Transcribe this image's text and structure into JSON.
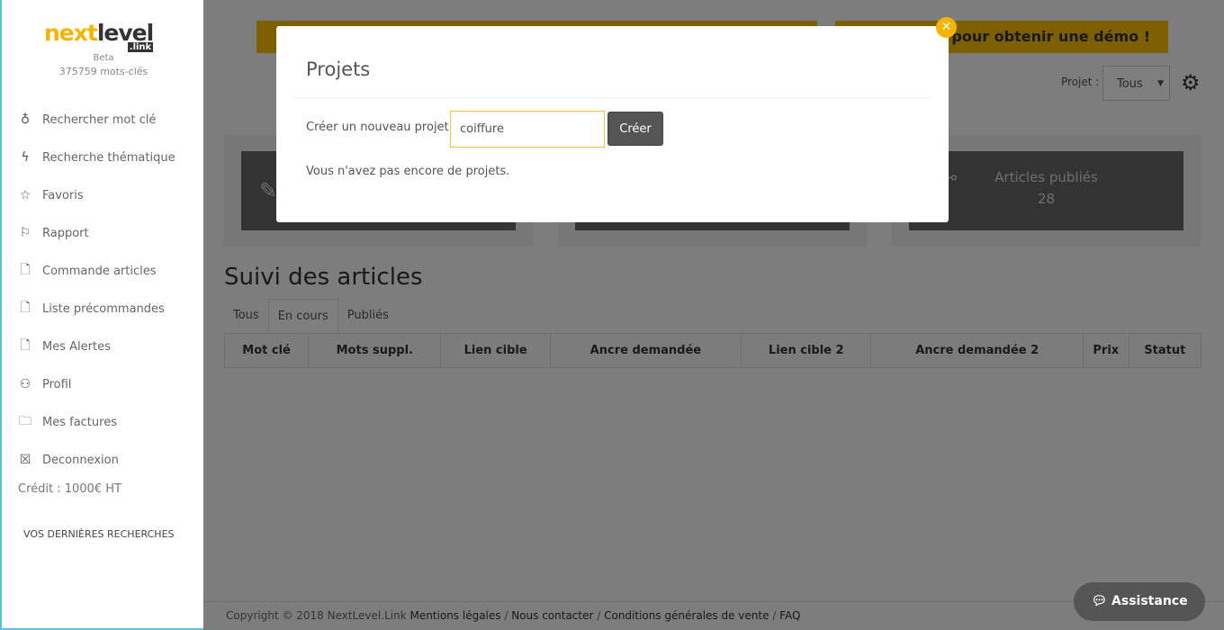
{
  "sidebar": {
    "logo": {
      "part1": "next",
      "part2": "level",
      "suffix": ".link"
    },
    "beta": "Beta",
    "keywords": "375759 mots-clés",
    "items": [
      {
        "icon": "award-icon",
        "label": "Rechercher mot clé"
      },
      {
        "icon": "bolt-icon",
        "label": "Recherche thématique"
      },
      {
        "icon": "star-icon",
        "label": "Favoris"
      },
      {
        "icon": "flag-icon",
        "label": "Rapport"
      },
      {
        "icon": "file-icon",
        "label": "Commande articles"
      },
      {
        "icon": "file-icon",
        "label": "Liste précommandes"
      },
      {
        "icon": "file-icon",
        "label": "Mes Alertes"
      },
      {
        "icon": "user-icon",
        "label": "Profil"
      },
      {
        "icon": "folder-icon",
        "label": "Mes factures"
      },
      {
        "icon": "close-box-icon",
        "label": "Deconnexion"
      }
    ],
    "credit": "Crédit : 1000€ HT",
    "recent": "VOS DERNIÈRES RECHERCHES"
  },
  "main": {
    "banner_right": "pour obtenir une démo !",
    "project_label": "Projet :",
    "project_value": "Tous",
    "cards": [
      {
        "title": "",
        "value": ""
      },
      {
        "title": "",
        "value": ""
      },
      {
        "title": "Articles publiés",
        "value": "28"
      }
    ],
    "title": "Suivi des articles",
    "tabs": [
      "Tous",
      "En cours",
      "Publiés"
    ],
    "active_tab": "En cours",
    "columns": [
      "Mot clé",
      "Mots suppl.",
      "Lien cible",
      "Ancre demandée",
      "Lien cible 2",
      "Ancre demandée 2",
      "Prix",
      "Statut"
    ],
    "footer": {
      "copyright": "Copyright © 2018 NextLevel.Link",
      "links": [
        "Mentions légales",
        "Nous contacter",
        "Conditions générales de vente",
        "FAQ"
      ]
    }
  },
  "modal": {
    "title": "Projets",
    "label": "Créer un nouveau projet :",
    "input_value": "coiffure",
    "button": "Créer",
    "empty": "Vous n'avez pas encore de projets."
  },
  "assistance": "Assistance",
  "colors": {
    "accent": "#f9be00",
    "sidebar_border": "#5bc0de"
  }
}
